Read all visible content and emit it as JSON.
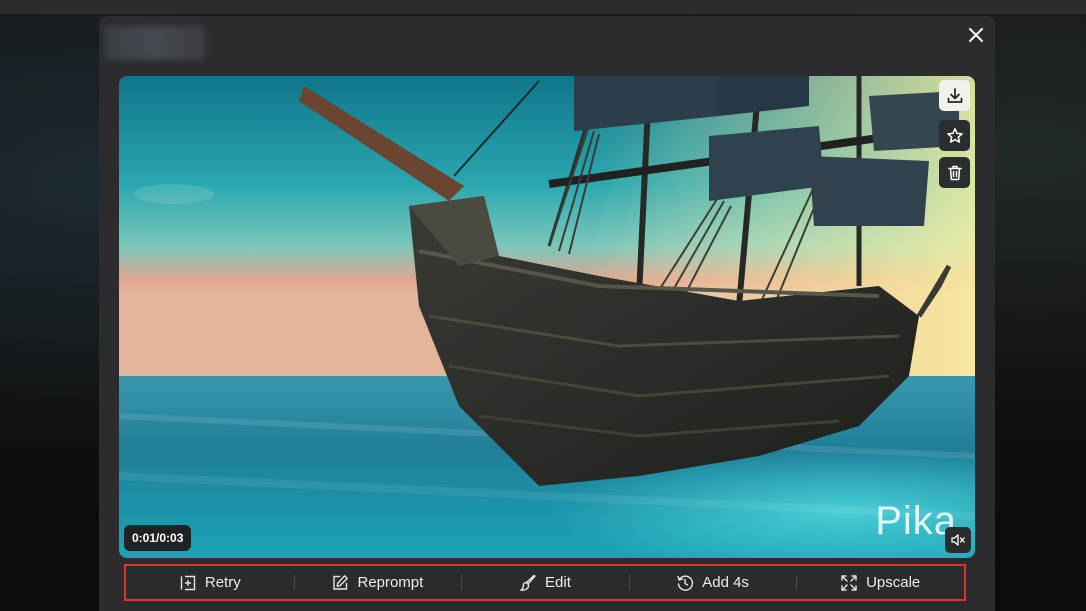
{
  "modal": {
    "close_icon": "close-icon"
  },
  "video": {
    "time": "0:01/0:03",
    "watermark": "Pika"
  },
  "side_actions": [
    {
      "icon": "download-icon"
    },
    {
      "icon": "star-icon"
    },
    {
      "icon": "trash-icon"
    }
  ],
  "toolbar": {
    "retry_label": "Retry",
    "reprompt_label": "Reprompt",
    "edit_label": "Edit",
    "add4s_label": "Add 4s",
    "upscale_label": "Upscale"
  },
  "colors": {
    "modal_bg": "#2c2c2e",
    "highlight_border": "#e0352c",
    "text": "#ececec"
  }
}
